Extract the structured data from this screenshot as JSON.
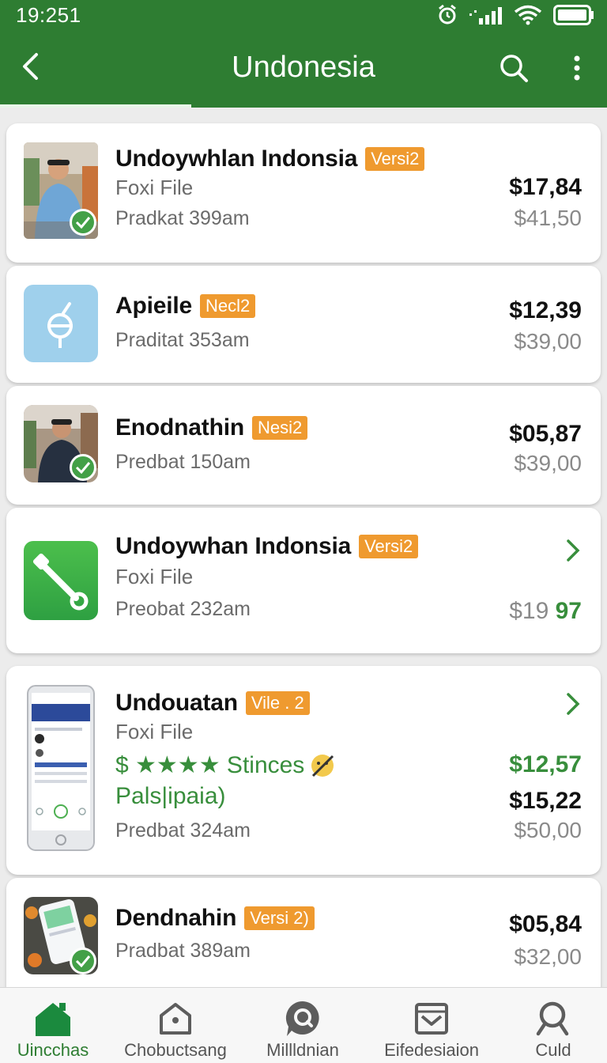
{
  "status_bar": {
    "time": "19:251"
  },
  "header": {
    "title": "Undonesia"
  },
  "items": [
    {
      "title": "Undoywhlan Indonsia",
      "tag": "Versi2",
      "subtitle": "Foxi File",
      "meta": "Pradkat 399am",
      "price": "$17,84",
      "price_old": "$41,50",
      "verified": true
    },
    {
      "title": "Apieile",
      "tag": "Necl2",
      "meta": "Praditat 353am",
      "price": "$12,39",
      "price_old": "$39,00"
    },
    {
      "title": "Enodnathin",
      "tag": "Nesi2",
      "meta": "Predbat 150am",
      "price": "$05,87",
      "price_old": "$39,00",
      "verified": true
    },
    {
      "title": "Undoywhan Indonsia",
      "tag": "Versi2",
      "subtitle": "Foxi File",
      "meta": "Preobat 232am",
      "price_prefix": "$19",
      "price_suffix": "97"
    },
    {
      "title": "Undouatan",
      "tag": "Vile . 2",
      "subtitle": "Foxi File",
      "rating_text": "$ ★★★★ Stinces",
      "extra_text": "Pals|ipaia)",
      "meta": "Predbat 324am",
      "price_green": "$12,57",
      "price": "$15,22",
      "price_old": "$50,00"
    },
    {
      "title": "Dendnahin",
      "tag": "Versi 2)",
      "meta": "Pradbat 389am",
      "price": "$05,84",
      "price_old": "$32,00",
      "verified": true
    }
  ],
  "bottom_nav": [
    {
      "label": "Uincchas",
      "icon": "home-icon",
      "active": true
    },
    {
      "label": "Chobuctsang",
      "icon": "house-outline-icon"
    },
    {
      "label": "Millldnian",
      "icon": "search-bubble-icon"
    },
    {
      "label": "Eifedesiaion",
      "icon": "inbox-icon"
    },
    {
      "label": "Culd",
      "icon": "search-icon"
    }
  ],
  "colors": {
    "header": "#2e7d32",
    "tag": "#ef9a2f",
    "green": "#388e3c",
    "check": "#43a047"
  }
}
